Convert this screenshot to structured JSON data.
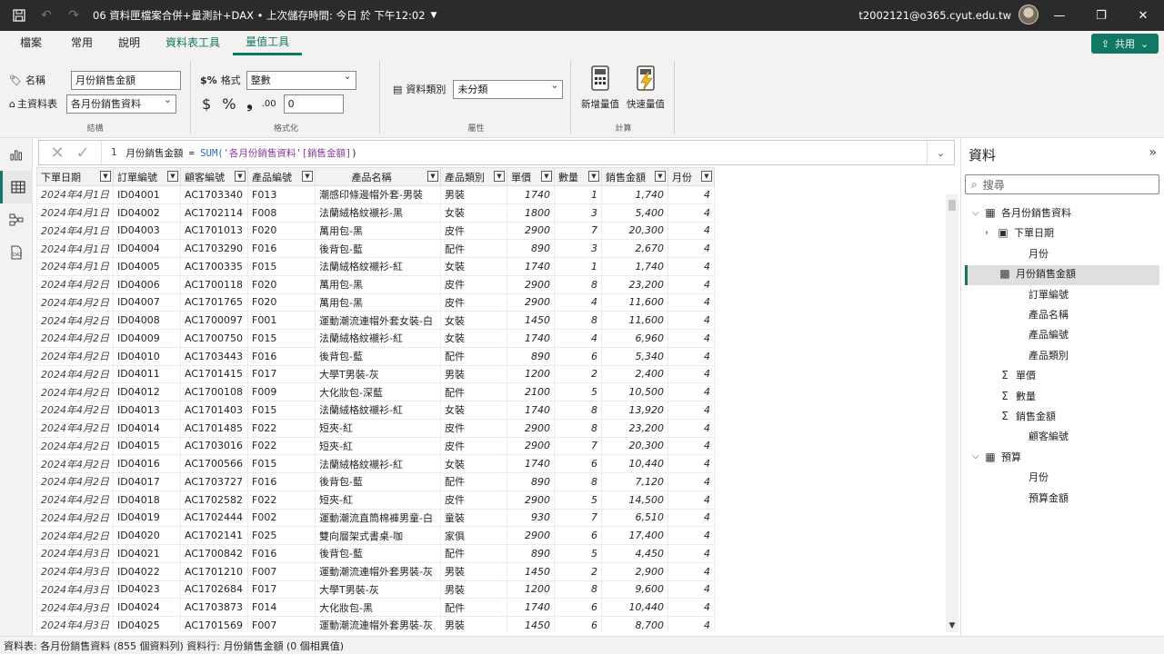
{
  "titlebar": {
    "doc_title": "06 資料匣檔案合併+量測計+DAX • 上次儲存時間: 今日 於 下午12:02",
    "account": "t2002121@o365.cyut.edu.tw"
  },
  "ribbon_tabs": [
    "檔案",
    "常用",
    "說明",
    "資料表工具",
    "量值工具"
  ],
  "share_label": "共用",
  "ribbon": {
    "name_label": "名稱",
    "name_value": "月份銷售金額",
    "home_table_label": "主資料表",
    "home_table_value": "各月份銷售資料",
    "structure_label": "結構",
    "format_label": "格式",
    "format_value": "整數",
    "decimal_value": "0",
    "formatting_label": "格式化",
    "data_category_label": "資料類別",
    "data_category_value": "未分類",
    "properties_label": "屬性",
    "new_measure_label": "新增量值",
    "quick_measure_label": "快速量值",
    "calculations_label": "計算"
  },
  "formula": {
    "line_no": "1",
    "measure": "月份銷售金額 = ",
    "fn": "SUM(",
    "ref": "'各月份銷售資料'[銷售金額]",
    "close": ")"
  },
  "table": {
    "columns": [
      "下單日期",
      "訂單編號",
      "顧客編號",
      "產品編號",
      "產品名稱",
      "產品類別",
      "單價",
      "數量",
      "銷售金額",
      "月份"
    ],
    "rows": [
      [
        "2024年4月1日",
        "ID04001",
        "AC1703340",
        "F013",
        "潮感印條邊帽外套-男裝",
        "男裝",
        "1740",
        "1",
        "1,740",
        "4"
      ],
      [
        "2024年4月1日",
        "ID04002",
        "AC1702114",
        "F008",
        "法蘭絨格紋襯衫-黑",
        "女裝",
        "1800",
        "3",
        "5,400",
        "4"
      ],
      [
        "2024年4月1日",
        "ID04003",
        "AC1701013",
        "F020",
        "萬用包-黑",
        "皮件",
        "2900",
        "7",
        "20,300",
        "4"
      ],
      [
        "2024年4月1日",
        "ID04004",
        "AC1703290",
        "F016",
        "後背包-藍",
        "配件",
        "890",
        "3",
        "2,670",
        "4"
      ],
      [
        "2024年4月1日",
        "ID04005",
        "AC1700335",
        "F015",
        "法蘭絨格紋襯衫-紅",
        "女裝",
        "1740",
        "1",
        "1,740",
        "4"
      ],
      [
        "2024年4月2日",
        "ID04006",
        "AC1700118",
        "F020",
        "萬用包-黑",
        "皮件",
        "2900",
        "8",
        "23,200",
        "4"
      ],
      [
        "2024年4月2日",
        "ID04007",
        "AC1701765",
        "F020",
        "萬用包-黑",
        "皮件",
        "2900",
        "4",
        "11,600",
        "4"
      ],
      [
        "2024年4月2日",
        "ID04008",
        "AC1700097",
        "F001",
        "運動潮流連帽外套女裝-白",
        "女裝",
        "1450",
        "8",
        "11,600",
        "4"
      ],
      [
        "2024年4月2日",
        "ID04009",
        "AC1700750",
        "F015",
        "法蘭絨格紋襯衫-紅",
        "女裝",
        "1740",
        "4",
        "6,960",
        "4"
      ],
      [
        "2024年4月2日",
        "ID04010",
        "AC1703443",
        "F016",
        "後背包-藍",
        "配件",
        "890",
        "6",
        "5,340",
        "4"
      ],
      [
        "2024年4月2日",
        "ID04011",
        "AC1701415",
        "F017",
        "大學T男裝-灰",
        "男裝",
        "1200",
        "2",
        "2,400",
        "4"
      ],
      [
        "2024年4月2日",
        "ID04012",
        "AC1700108",
        "F009",
        "大化妝包-深藍",
        "配件",
        "2100",
        "5",
        "10,500",
        "4"
      ],
      [
        "2024年4月2日",
        "ID04013",
        "AC1701403",
        "F015",
        "法蘭絨格紋襯衫-紅",
        "女裝",
        "1740",
        "8",
        "13,920",
        "4"
      ],
      [
        "2024年4月2日",
        "ID04014",
        "AC1701485",
        "F022",
        "短夾-紅",
        "皮件",
        "2900",
        "8",
        "23,200",
        "4"
      ],
      [
        "2024年4月2日",
        "ID04015",
        "AC1703016",
        "F022",
        "短夾-紅",
        "皮件",
        "2900",
        "7",
        "20,300",
        "4"
      ],
      [
        "2024年4月2日",
        "ID04016",
        "AC1700566",
        "F015",
        "法蘭絨格紋襯衫-紅",
        "女裝",
        "1740",
        "6",
        "10,440",
        "4"
      ],
      [
        "2024年4月2日",
        "ID04017",
        "AC1703727",
        "F016",
        "後背包-藍",
        "配件",
        "890",
        "8",
        "7,120",
        "4"
      ],
      [
        "2024年4月2日",
        "ID04018",
        "AC1702582",
        "F022",
        "短夾-紅",
        "皮件",
        "2900",
        "5",
        "14,500",
        "4"
      ],
      [
        "2024年4月2日",
        "ID04019",
        "AC1702444",
        "F002",
        "運動潮流直筒棉褲男童-白",
        "童裝",
        "930",
        "7",
        "6,510",
        "4"
      ],
      [
        "2024年4月2日",
        "ID04020",
        "AC1702141",
        "F025",
        "雙向層架式書桌-咖",
        "家俱",
        "2900",
        "6",
        "17,400",
        "4"
      ],
      [
        "2024年4月3日",
        "ID04021",
        "AC1700842",
        "F016",
        "後背包-藍",
        "配件",
        "890",
        "5",
        "4,450",
        "4"
      ],
      [
        "2024年4月3日",
        "ID04022",
        "AC1701210",
        "F007",
        "運動潮流連帽外套男裝-灰",
        "男裝",
        "1450",
        "2",
        "2,900",
        "4"
      ],
      [
        "2024年4月3日",
        "ID04023",
        "AC1702684",
        "F017",
        "大學T男裝-灰",
        "男裝",
        "1200",
        "8",
        "9,600",
        "4"
      ],
      [
        "2024年4月3日",
        "ID04024",
        "AC1703873",
        "F014",
        "大化妝包-黑",
        "配件",
        "1740",
        "6",
        "10,440",
        "4"
      ],
      [
        "2024年4月3日",
        "ID04025",
        "AC1701569",
        "F007",
        "運動潮流連帽外套男裝-灰",
        "男裝",
        "1450",
        "6",
        "8,700",
        "4"
      ]
    ]
  },
  "data_pane": {
    "title": "資料",
    "search_placeholder": "搜尋",
    "items": [
      {
        "label": "各月份銷售資料",
        "icon": "table-icon"
      },
      {
        "label": "下單日期",
        "icon": "calendar-icon"
      },
      {
        "label": "月份",
        "icon": ""
      },
      {
        "label": "月份銷售金額",
        "icon": "calculator-icon"
      },
      {
        "label": "訂單編號",
        "icon": ""
      },
      {
        "label": "產品名稱",
        "icon": ""
      },
      {
        "label": "產品編號",
        "icon": ""
      },
      {
        "label": "產品類別",
        "icon": ""
      },
      {
        "label": "單價",
        "icon": "sigma-icon"
      },
      {
        "label": "數量",
        "icon": "sigma-icon"
      },
      {
        "label": "銷售金額",
        "icon": "sigma-icon"
      },
      {
        "label": "顧客編號",
        "icon": ""
      },
      {
        "label": "預算",
        "icon": "table-icon"
      },
      {
        "label": "月份",
        "icon": ""
      },
      {
        "label": "預算金額",
        "icon": ""
      }
    ]
  },
  "statusbar": "資料表: 各月份銷售資料 (855 個資料列) 資料行: 月份銷售金額 (0 個相異值)",
  "colors": {
    "accent": "#117865",
    "titlebar": "#2b2b2b",
    "ribbon": "#f3f2f1"
  }
}
